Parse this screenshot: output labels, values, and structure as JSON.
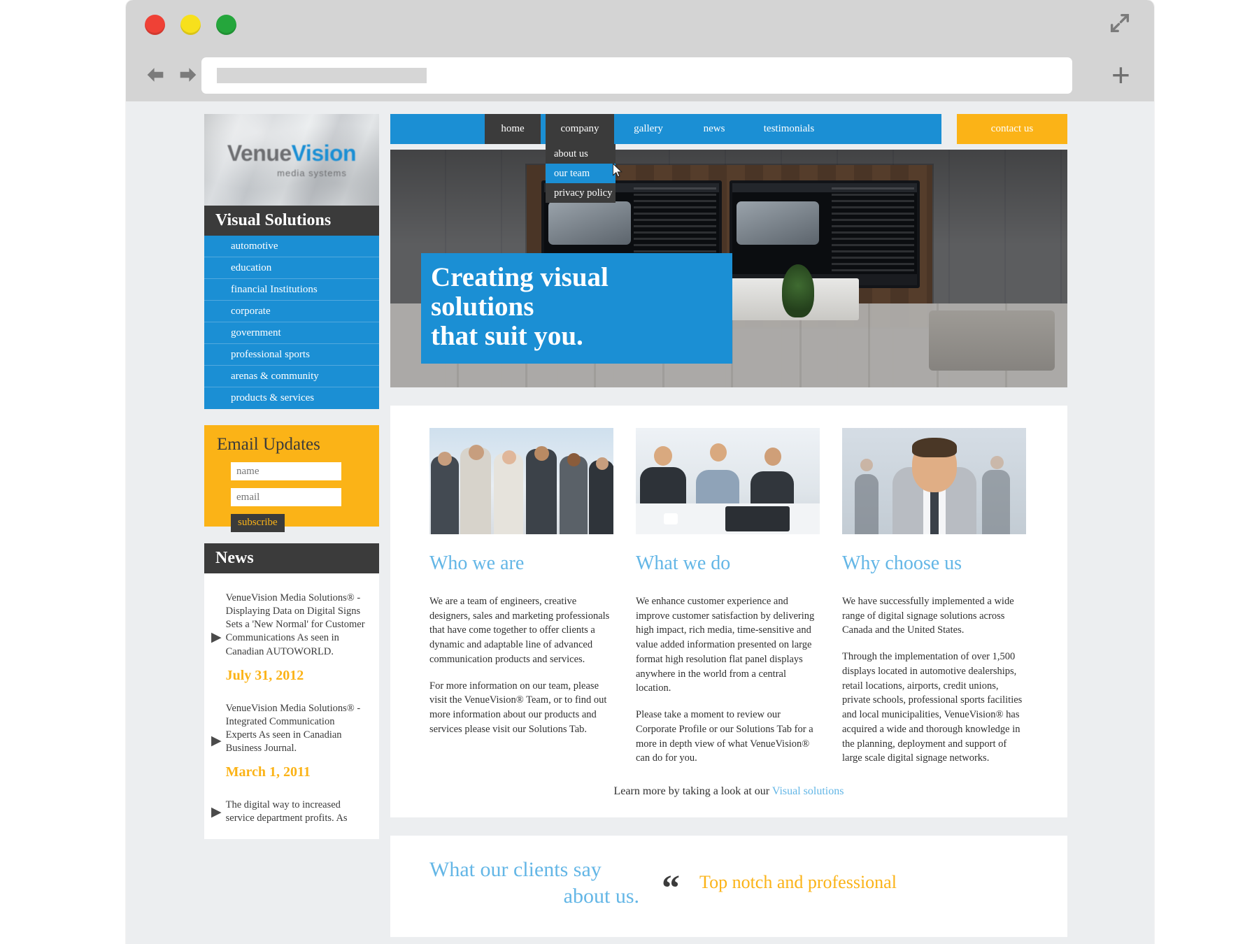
{
  "browser": {
    "window_controls": [
      "close",
      "minimize",
      "maximize"
    ],
    "back_icon": "back-arrow-icon",
    "forward_icon": "forward-arrow-icon",
    "url_value": "",
    "url_placeholder": "",
    "add_tab_label": "+",
    "expand_icon": "expand-icon"
  },
  "site": {
    "logo_main_venue": "Venue",
    "logo_main_vision": "Vision",
    "logo_sub": "media systems"
  },
  "nav": {
    "items": [
      {
        "label": "home",
        "state": "active"
      },
      {
        "label": "company",
        "state": "open"
      },
      {
        "label": "gallery",
        "state": "normal"
      },
      {
        "label": "news",
        "state": "normal"
      },
      {
        "label": "testimonials",
        "state": "normal"
      }
    ],
    "contact_label": "contact us",
    "dropdown": [
      {
        "label": "about us",
        "state": "normal"
      },
      {
        "label": "our team",
        "state": "hover"
      },
      {
        "label": "privacy policy",
        "state": "normal"
      }
    ]
  },
  "sidebar": {
    "solutions_title": "Visual Solutions",
    "solutions": [
      {
        "label": "automotive"
      },
      {
        "label": "education"
      },
      {
        "label": "financial Institutions"
      },
      {
        "label": "corporate"
      },
      {
        "label": "government"
      },
      {
        "label": "professional sports"
      },
      {
        "label": "arenas & community"
      },
      {
        "label": "products & services"
      }
    ],
    "email_box": {
      "title": "Email Updates",
      "name_placeholder": "name",
      "name_value": "",
      "email_placeholder": "email",
      "email_value": "",
      "subscribe_label": "subscribe"
    },
    "news": {
      "title": "News",
      "items": [
        {
          "text": "VenueVision Media Solutions® - Displaying Data on Digital Signs Sets a 'New Normal' for Customer Communications As seen in Canadian AUTOWORLD.",
          "date": "July 31, 2012"
        },
        {
          "text": "VenueVision Media Solutions® - Integrated Communication Experts As seen in Canadian Business Journal.",
          "date": "March 1, 2011"
        },
        {
          "text": "The digital way to increased service department profits. As",
          "date": ""
        }
      ]
    }
  },
  "hero": {
    "caption_line1": "Creating visual solutions",
    "caption_line2": "that suit you."
  },
  "content": {
    "columns": [
      {
        "title": "Who we are",
        "image": "group-of-business-people-photo",
        "paragraphs": [
          "We are a team of engineers, creative designers, sales and marketing professionals that have come together to offer clients a dynamic and adaptable line of advanced communication products and services.",
          "For more information on our team, please visit the VenueVision® Team, or to find out more information about our products and services please visit our Solutions Tab."
        ]
      },
      {
        "title": "What we do",
        "image": "business-meeting-photo",
        "paragraphs": [
          "We enhance customer experience and improve customer satisfaction by delivering high impact, rich media, time-sensitive and value added information presented on large format high resolution flat panel displays anywhere in the world from a central location.",
          "Please take a moment to review our Corporate Profile or our Solutions Tab for a more in depth view of what VenueVision® can do for you."
        ]
      },
      {
        "title": "Why choose us",
        "image": "businessman-portrait-photo",
        "paragraphs": [
          "We have successfully implemented a wide range of digital signage solutions across Canada and the United States.",
          " Through the implementation of over 1,500 displays located in automotive dealerships, retail locations, airports, credit unions, private schools, professional sports facilities and local municipalities, VenueVision® has acquired a wide and thorough knowledge in the planning, deployment and support of large scale digital signage networks."
        ]
      }
    ],
    "learn_more_prefix": "Learn more by taking a look at our ",
    "learn_more_link": "Visual solutions"
  },
  "testimonials": {
    "title_line1": "What our clients say",
    "title_line2": "about us.",
    "quote_mark": "“",
    "quote_text": "Top notch and professional"
  },
  "colors": {
    "brand_blue": "#1b8fd4",
    "brand_orange": "#fbb317",
    "dark": "#3b3b3b",
    "heading_blue": "#63b6e6",
    "page_bg": "#eceef0"
  }
}
